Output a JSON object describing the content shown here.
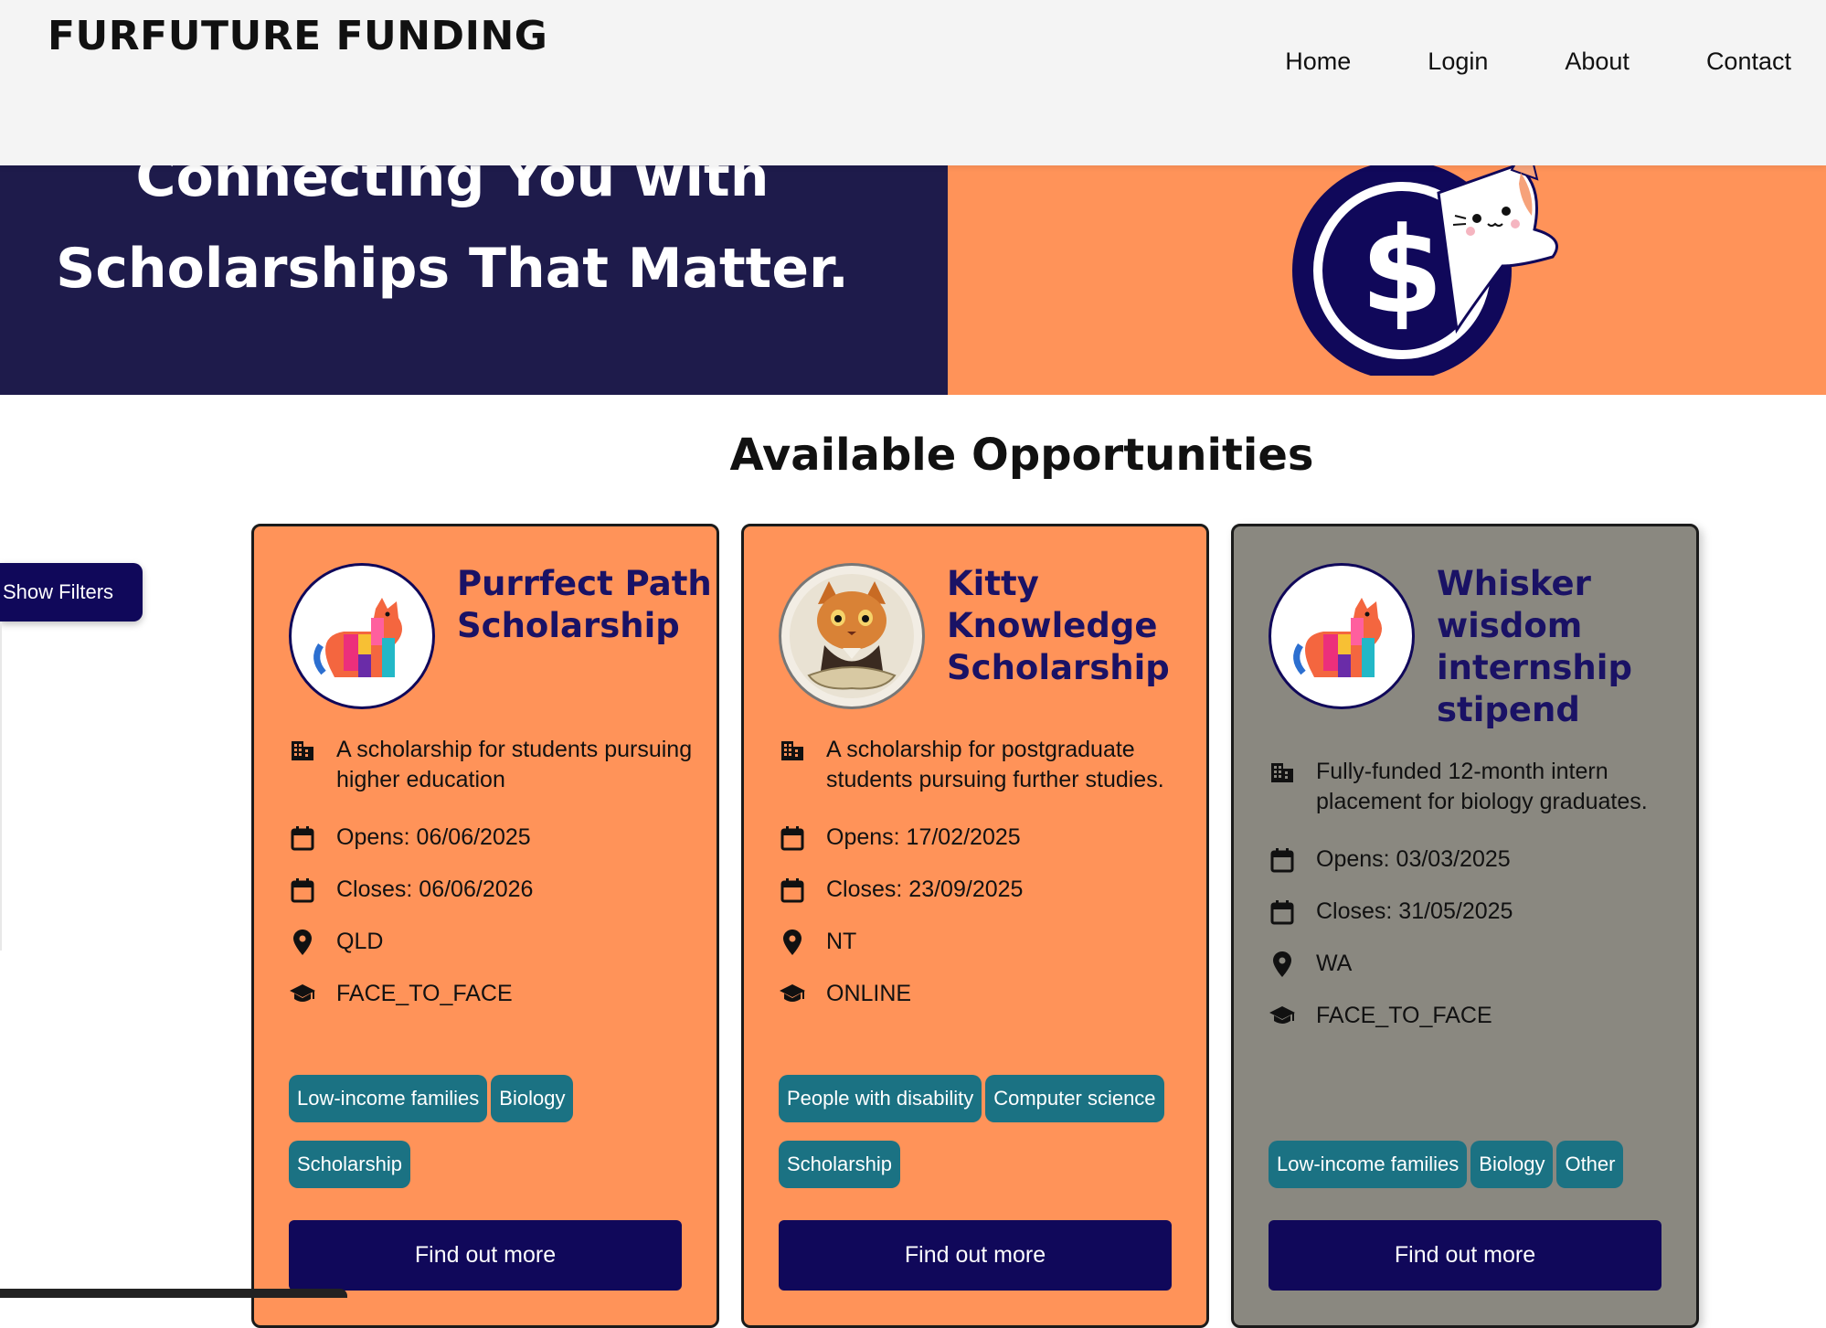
{
  "header": {
    "logo": "FURFUTURE FUNDING",
    "nav": [
      "Home",
      "Login",
      "About",
      "Contact"
    ]
  },
  "hero": {
    "line1": "Connecting You with",
    "line2": "Scholarships That Matter.",
    "left_color": "#1e1b4b",
    "right_color": "#ff9359"
  },
  "section_title": "Available Opportunities",
  "filters_button": "Show Filters",
  "cards": [
    {
      "title": "Purrfect Path Scholarship",
      "description": "A scholarship for students pursuing higher education",
      "opens": "Opens: 06/06/2025",
      "closes": "Closes: 06/06/2026",
      "location": "QLD",
      "mode": "FACE_TO_FACE",
      "tags": [
        "Low-income families",
        "Biology",
        "Scholarship"
      ],
      "button": "Find out more",
      "background": "#ff9359"
    },
    {
      "title": "Kitty Knowledge Scholarship",
      "description": "A scholarship for postgraduate students pursuing further studies.",
      "opens": "Opens: 17/02/2025",
      "closes": "Closes: 23/09/2025",
      "location": "NT",
      "mode": "ONLINE",
      "tags": [
        "People with disability",
        "Computer science",
        "Scholarship"
      ],
      "button": "Find out more",
      "background": "#ff9359"
    },
    {
      "title": "Whisker wisdom internship stipend",
      "description": "Fully-funded 12-month intern placement for biology graduates.",
      "opens": "Opens: 03/03/2025",
      "closes": "Closes: 31/05/2025",
      "location": "WA",
      "mode": "FACE_TO_FACE",
      "tags": [
        "Low-income families",
        "Biology",
        "Other"
      ],
      "button": "Find out more",
      "background": "#8a8880"
    }
  ],
  "colors": {
    "navy": "#10085a",
    "tag_teal": "#1b7283",
    "title_text": "#1a1265"
  },
  "icons": [
    "building-icon",
    "calendar-icon",
    "location-pin-icon",
    "graduation-cap-icon",
    "cat-logo-icon",
    "dollar-coin-icon"
  ]
}
